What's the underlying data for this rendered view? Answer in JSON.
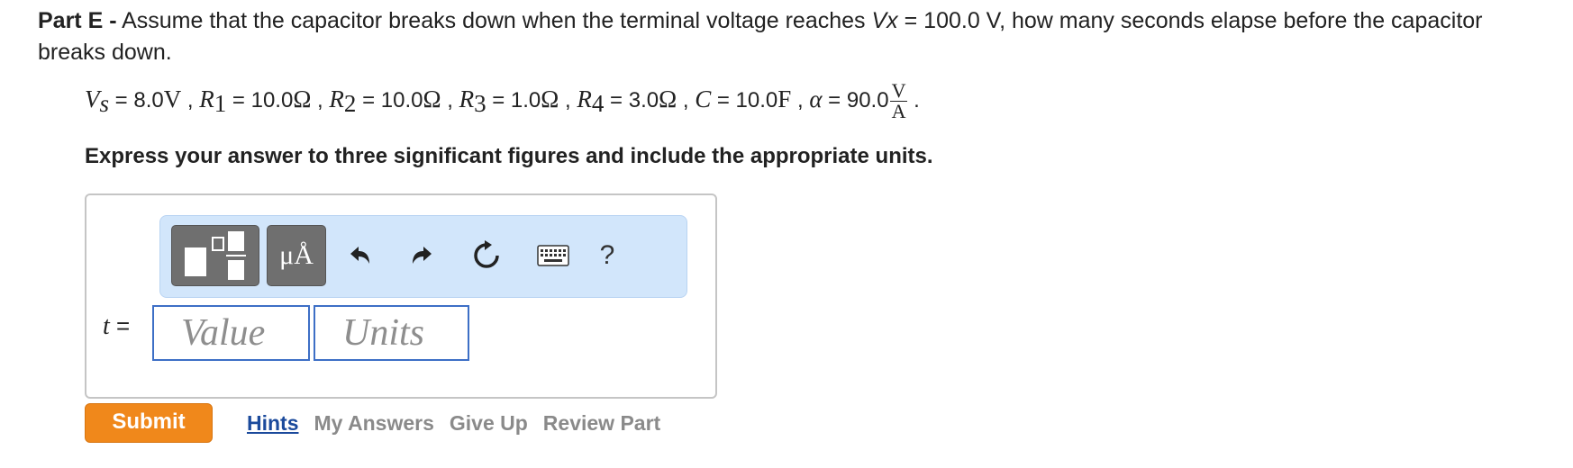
{
  "question": {
    "part_label": "Part E -",
    "text_before_var": " Assume that the capacitor breaks down when the terminal voltage reaches ",
    "var": "Vx",
    "text_after_var": " = 100.0 V, how many seconds elapse before the capacitor breaks down."
  },
  "givens": {
    "vs_sym": "V",
    "vs_sub": "s",
    "vs_val": " = 8.0",
    "vs_unit": "V",
    "r1_sym": "R",
    "r1_sub": "1",
    "r1_val": " = 10.0",
    "r1_unit": "Ω",
    "r2_sym": "R",
    "r2_sub": "2",
    "r2_val": " = 10.0",
    "r2_unit": "Ω",
    "r3_sym": "R",
    "r3_sub": "3",
    "r3_val": " = 1.0",
    "r3_unit": "Ω",
    "r4_sym": "R",
    "r4_sub": "4",
    "r4_val": " = 3.0",
    "r4_unit": "Ω",
    "c_sym": "C",
    "c_val": " = 10.0",
    "c_unit": "F",
    "alpha_sym": "α",
    "alpha_val": " = 90.0",
    "alpha_num": "V",
    "alpha_den": "A",
    "sep": " , ",
    "end": " ."
  },
  "instruction": "Express your answer to three significant figures and include the appropriate units.",
  "toolbar": {
    "units_label": "μÅ",
    "help_label": "?"
  },
  "answer": {
    "var_label": "t",
    "equals": " =",
    "value_placeholder": "Value",
    "units_placeholder": "Units"
  },
  "actions": {
    "submit": "Submit",
    "hints": "Hints",
    "my_answers": "My Answers",
    "give_up": "Give Up",
    "review_part": "Review Part"
  },
  "colors": {
    "submit_bg": "#f0881b",
    "toolbar_bg": "#d2e6fb",
    "input_border": "#3d6fc6",
    "hints_link": "#1b4a9c"
  }
}
